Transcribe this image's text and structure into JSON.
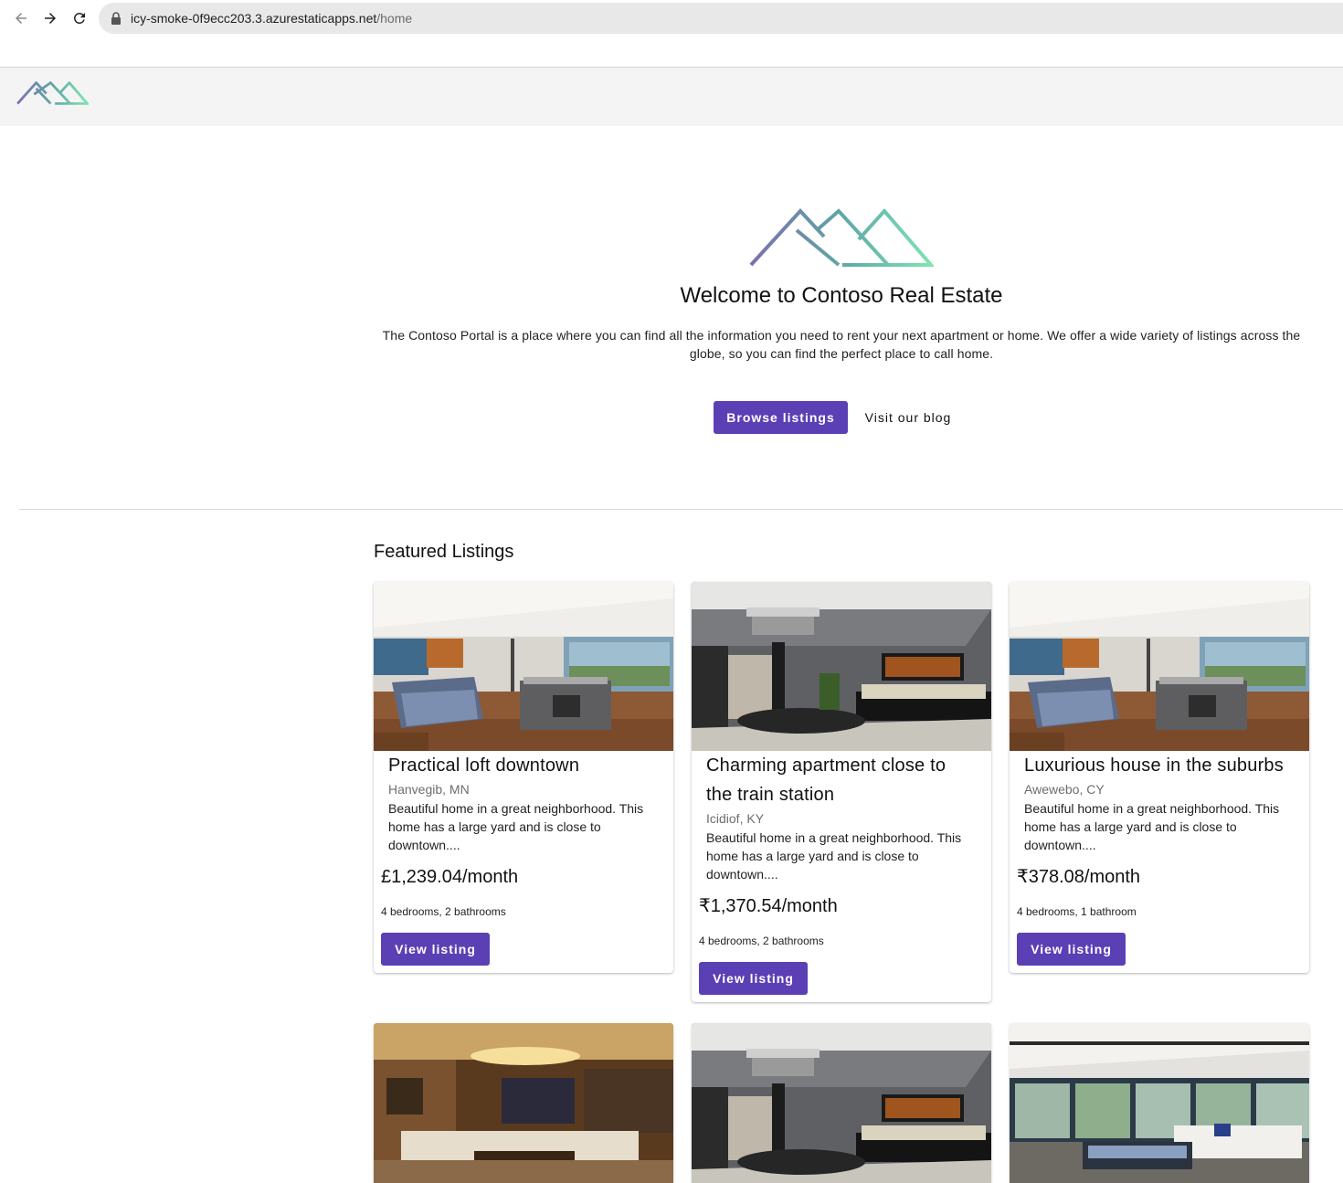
{
  "browser": {
    "url_host": "icy-smoke-0f9ecc203.3.azurestaticapps.net",
    "url_path": "/home"
  },
  "hero": {
    "title": "Welcome to Contoso Real Estate",
    "description": "The Contoso Portal is a place where you can find all the information you need to rent your next apartment or home. We offer a wide variety of listings across the globe, so you can find the perfect place to call home.",
    "browse_label": "Browse listings",
    "blog_label": "Visit our blog"
  },
  "featured": {
    "title": "Featured Listings",
    "listings": [
      {
        "title": "Practical loft downtown",
        "location": "Hanvegib, MN",
        "description": "Beautiful home in a great neighborhood. This home has a large yard and is close to downtown....",
        "price": "£1,239.04/month",
        "rooms": "4 bedrooms, 2 bathrooms",
        "button": "View listing",
        "image": "loft-interior"
      },
      {
        "title": "Charming apartment close to the train station",
        "location": "Icidiof, KY",
        "description": "Beautiful home in a great neighborhood. This home has a large yard and is close to downtown....",
        "price": "₹1,370.54/month",
        "rooms": "4 bedrooms, 2 bathrooms",
        "button": "View listing",
        "image": "living-room-chandelier"
      },
      {
        "title": "Luxurious house in the suburbs",
        "location": "Awewebo, CY",
        "description": "Beautiful home in a great neighborhood. This home has a large yard and is close to downtown....",
        "price": "₹378.08/month",
        "rooms": "4 bedrooms, 1 bathroom",
        "button": "View listing",
        "image": "loft-interior"
      }
    ],
    "second_row_images": [
      "warm-living-room",
      "living-room-chandelier",
      "bright-loft-living"
    ]
  },
  "colors": {
    "primary": "#5b3fb5",
    "header_bg": "#f4f4f4",
    "logo_gradient_start": "#7b6fb0",
    "logo_gradient_end": "#7fe3b2"
  }
}
